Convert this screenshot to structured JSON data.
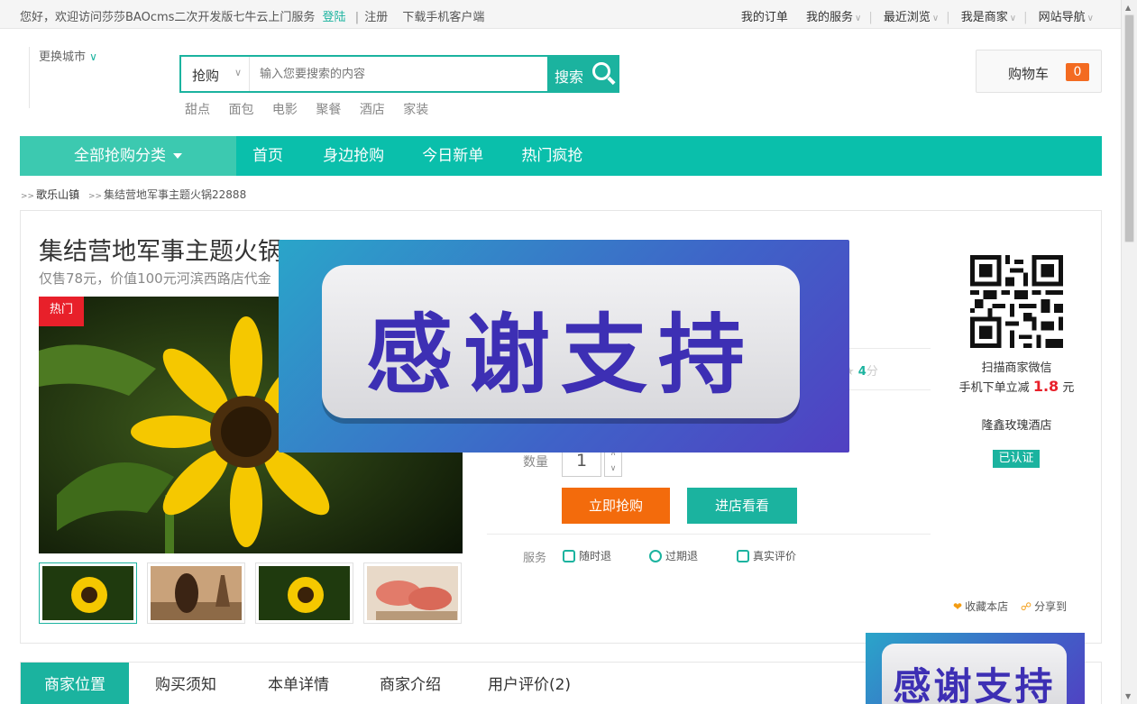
{
  "topbar": {
    "welcome": "您好，欢迎访问莎莎BAOcms二次开发版七牛云上门服务",
    "login": "登陆",
    "separator": "|",
    "register": "注册",
    "download": "下载手机客户端",
    "links": [
      "我的订单",
      "我的服务",
      "最近浏览",
      "我是商家",
      "网站导航"
    ]
  },
  "header": {
    "city_switch": "更换城市",
    "search_type": "抢购",
    "search_placeholder": "输入您要搜索的内容",
    "search_button": "搜索",
    "hot_words": [
      "甜点",
      "面包",
      "电影",
      "聚餐",
      "酒店",
      "家装"
    ],
    "cart_label": "购物车",
    "cart_count": "0"
  },
  "nav": {
    "all_categories": "全部抢购分类",
    "links": [
      "首页",
      "身边抢购",
      "今日新单",
      "热门疯抢"
    ]
  },
  "breadcrumb": {
    "arrow": ">>",
    "city": "歌乐山镇",
    "current": "集结营地军事主题火锅22888"
  },
  "product": {
    "title": "集结营地军事主题火锅22888",
    "subtitle": "仅售78元，价值100元河滨西路店代金",
    "hot_badge": "热门",
    "rating": "4",
    "rating_unit": "分",
    "quantity_label": "数量",
    "quantity": "1",
    "buy_button": "立即抢购",
    "shop_button": "进店看看",
    "service_label": "服务",
    "services": [
      "随时退",
      "过期退",
      "真实评价"
    ]
  },
  "merchant": {
    "scan_line1": "扫描商家微信",
    "scan_line2": "手机下单立减",
    "discount": "1.8",
    "currency": "元",
    "store_name": "隆鑫玫瑰酒店",
    "verified": "已认证",
    "favorite": "收藏本店",
    "share": "分享到"
  },
  "ads": {
    "text": "感谢支持"
  },
  "tabs": [
    "商家位置",
    "购买须知",
    "本单详情",
    "商家介绍",
    "用户评价(2)"
  ],
  "colors": {
    "accent": "#1bb39f",
    "nav": "#0abfab",
    "buy": "#f36b0c",
    "hot": "#e8202a"
  }
}
